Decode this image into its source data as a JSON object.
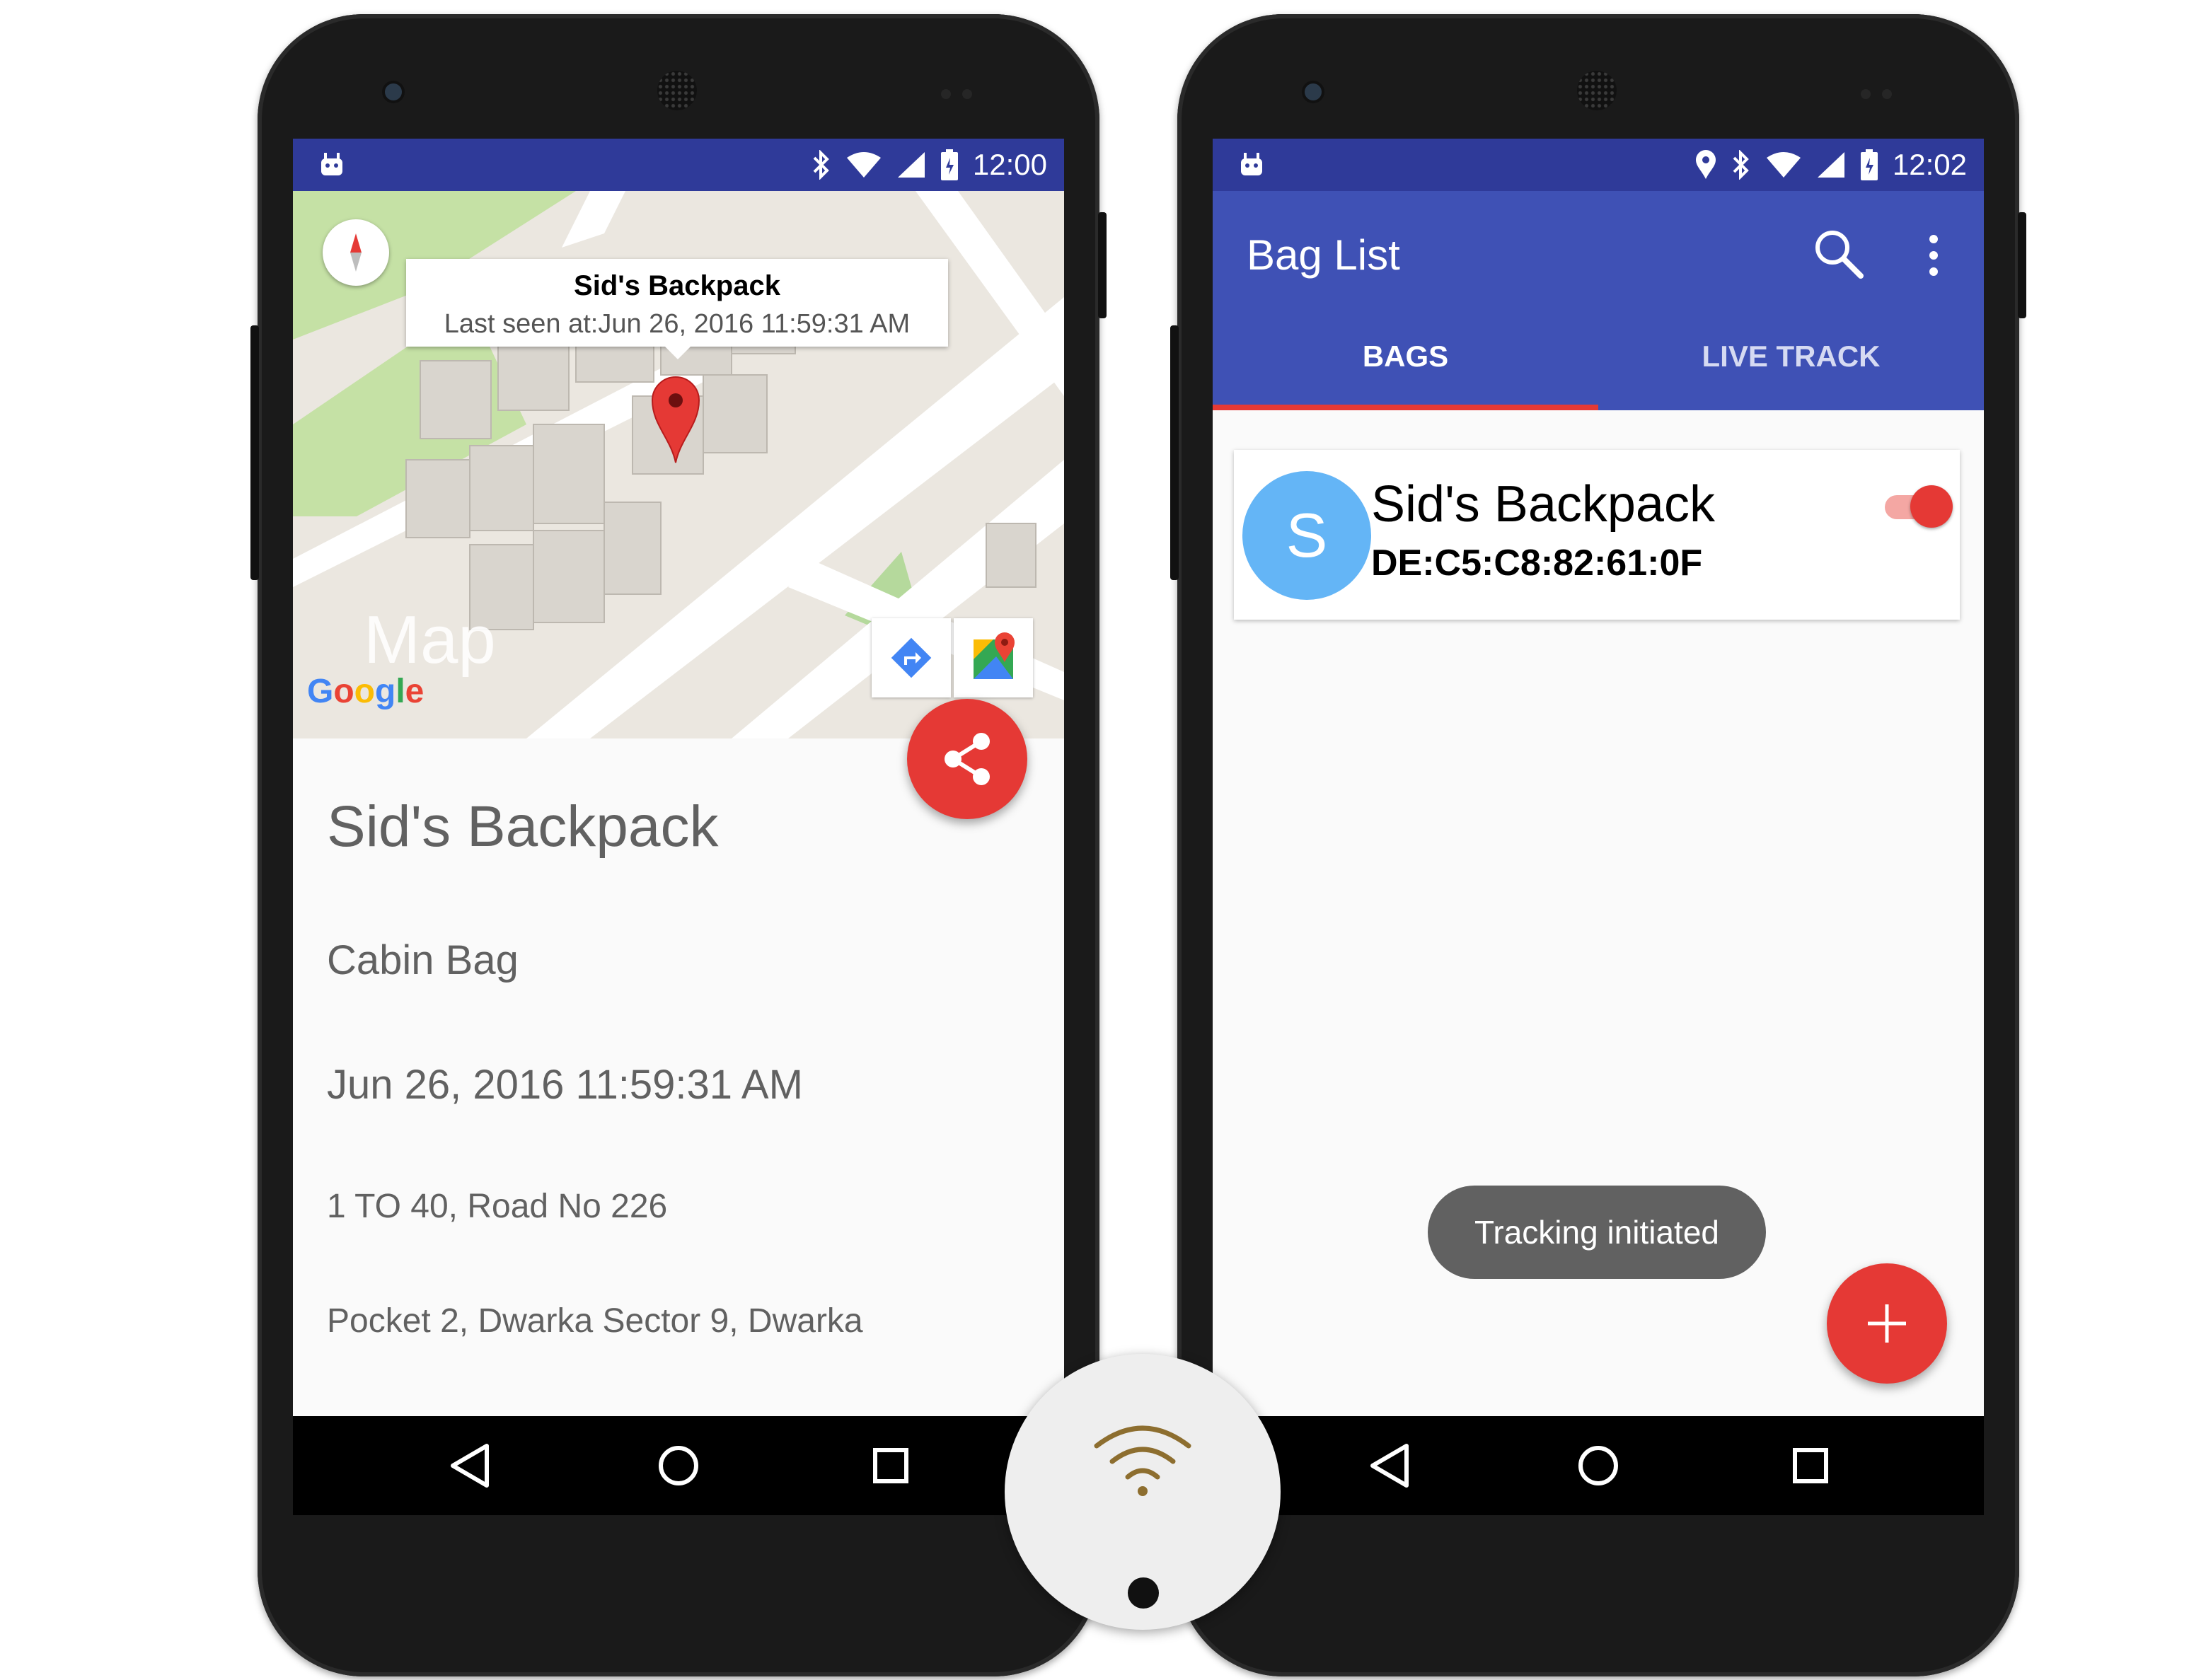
{
  "left_phone": {
    "status_time": "12:00",
    "map": {
      "watermark": "Map",
      "google_logo": [
        "G",
        "o",
        "o",
        "g",
        "l",
        "e"
      ],
      "marker_title": "Sid's Backpack",
      "marker_snippet": "Last seen at:Jun 26, 2016 11:59:31 AM"
    },
    "detail": {
      "name": "Sid's Backpack",
      "type": "Cabin Bag",
      "last_seen": "Jun 26, 2016 11:59:31 AM",
      "address_line1": "1 TO 40, Road No 226",
      "address_line2": "Pocket 2, Dwarka Sector 9, Dwarka"
    },
    "icons": [
      "android-debug-icon",
      "bluetooth-icon",
      "wifi-icon",
      "signal-icon",
      "battery-icon",
      "compass-icon",
      "map-pin-icon",
      "directions-icon",
      "google-maps-icon",
      "share-icon",
      "back-icon",
      "home-icon",
      "recents-icon"
    ]
  },
  "right_phone": {
    "status_time": "12:02",
    "app_title": "Bag List",
    "tabs": [
      "BAGS",
      "LIVE TRACK"
    ],
    "active_tab": "BAGS",
    "bags": [
      {
        "avatar_letter": "S",
        "name": "Sid's Backpack",
        "mac": "DE:C5:C8:82:61:0F",
        "tracking_enabled": true
      }
    ],
    "toast": "Tracking initiated",
    "icons": [
      "android-debug-icon",
      "location-icon",
      "bluetooth-icon",
      "wifi-icon",
      "signal-icon",
      "battery-icon",
      "search-icon",
      "more-vert-icon",
      "add-icon",
      "back-icon",
      "home-icon",
      "recents-icon"
    ]
  },
  "colors": {
    "status_bar": "#2f3a99",
    "primary": "#3f51b5",
    "accent": "#e53935",
    "avatar": "#64b5f6",
    "toast_bg": "#616161"
  },
  "tag_device": {
    "icon": "wireless-signal-icon"
  }
}
